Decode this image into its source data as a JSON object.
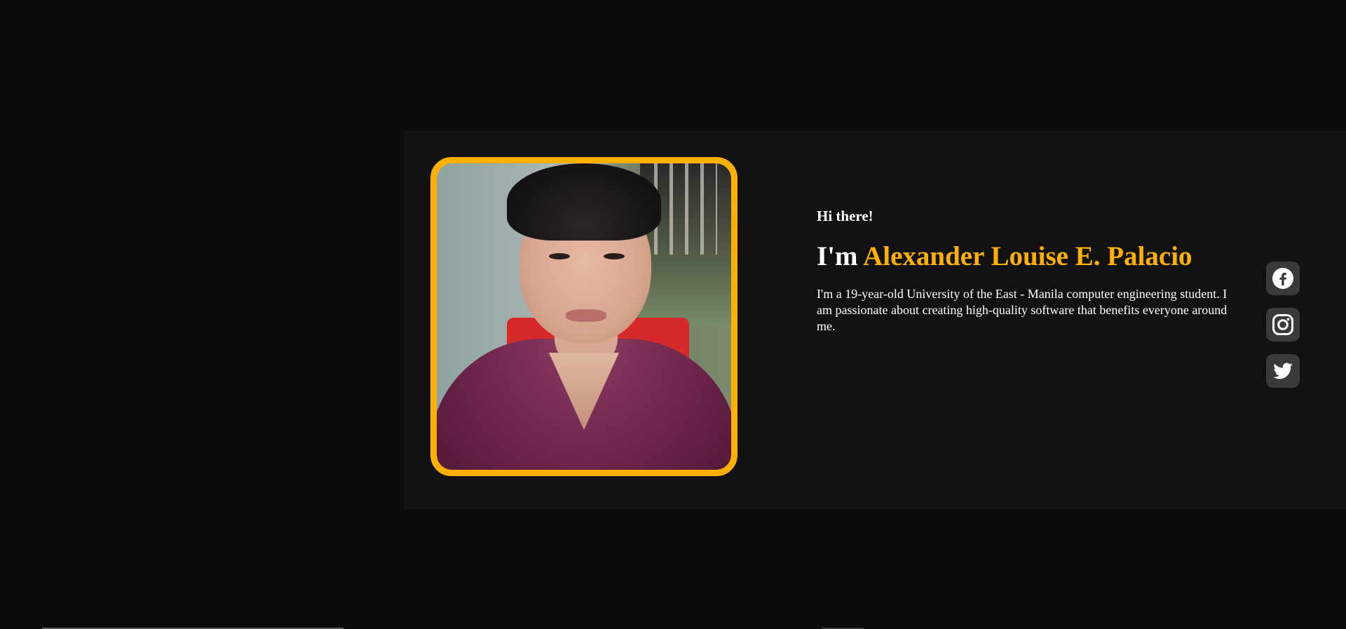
{
  "hero": {
    "greeting": "Hi there!",
    "intro_prefix": "I'm ",
    "name": "Alexander Louise E. Palacio",
    "bio": "I'm a 19-year-old University of the East - Manila computer engineering student. I am passionate about creating high-quality software that benefits everyone around me.",
    "accent_color": "#ffb000",
    "background_color": "#121212"
  },
  "social": [
    {
      "icon": "facebook-icon"
    },
    {
      "icon": "instagram-icon"
    },
    {
      "icon": "twitter-icon"
    }
  ],
  "colors": {
    "page_background": "#0b0b0b",
    "social_button_bg": "#3a3a3a",
    "text": "#ffffff"
  }
}
